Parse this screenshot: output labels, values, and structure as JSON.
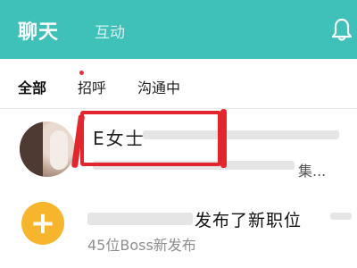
{
  "header": {
    "tabs": [
      {
        "label": "聊天",
        "active": true
      },
      {
        "label": "互动",
        "active": false
      }
    ],
    "notification_icon": "bell-icon",
    "background_color": "#3fc0b8"
  },
  "filters": {
    "items": [
      {
        "label": "全部",
        "active": true
      },
      {
        "label": "招呼",
        "has_dot": true
      },
      {
        "label": "沟通中",
        "active": false
      }
    ],
    "dot_color": "#e2323a"
  },
  "conversations": [
    {
      "name": "E女士",
      "preview_tail": "集...",
      "avatar": "photo",
      "highlight_color": "#e3262e"
    },
    {
      "title": "发布了新职位",
      "subtitle": "45位Boss新发布",
      "avatar_icon": "plus-icon",
      "avatar_color": "#f6b52d"
    }
  ]
}
